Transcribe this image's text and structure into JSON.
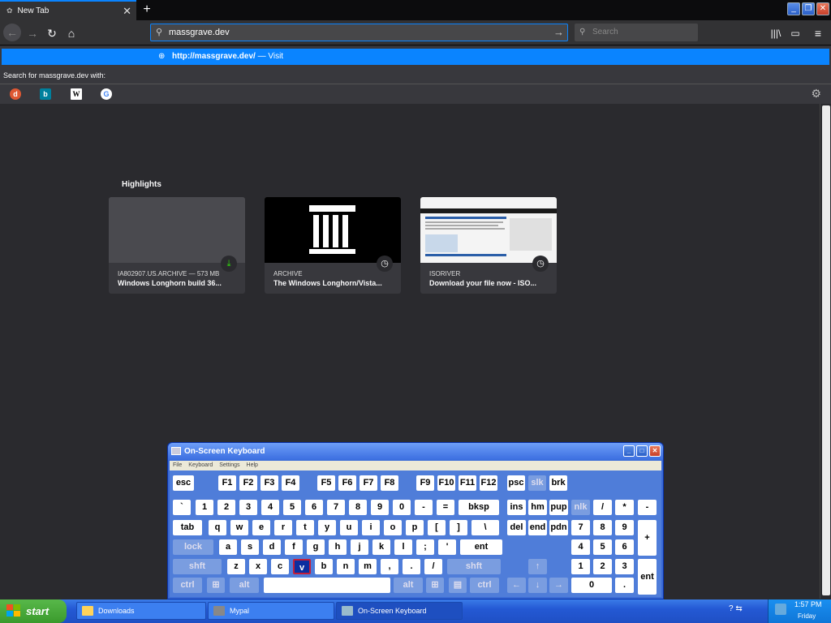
{
  "browser": {
    "tab_title": "New Tab",
    "tab_close": "✕",
    "new_tab": "+",
    "url_value": "massgrave.dev",
    "search_placeholder": "Search"
  },
  "dropdown": {
    "suggestion_url": "http://massgrave.dev/",
    "suggestion_action": "— Visit",
    "search_for_label": "Search for massgrave.dev with:",
    "engines": [
      "duckduckgo",
      "bing",
      "wikipedia",
      "google"
    ]
  },
  "highlights": {
    "title": "Highlights",
    "cards": [
      {
        "source": "IA802907.US.ARCHIVE — 573 MB",
        "title": "Windows Longhorn build 36...",
        "badge": "download-icon"
      },
      {
        "source": "ARCHIVE",
        "title": "The Windows Longhorn/Vista...",
        "badge": "clock-icon"
      },
      {
        "source": "ISORIVER",
        "title": "Download your file now - ISO...",
        "badge": "clock-icon"
      }
    ]
  },
  "osk": {
    "title": "On-Screen Keyboard",
    "menu": [
      "File",
      "Keyboard",
      "Settings",
      "Help"
    ],
    "rows": {
      "r0": [
        "esc",
        "F1",
        "F2",
        "F3",
        "F4",
        "F5",
        "F6",
        "F7",
        "F8",
        "F9",
        "F10",
        "F11",
        "F12",
        "psc",
        "slk",
        "brk"
      ],
      "r1": [
        "`",
        "1",
        "2",
        "3",
        "4",
        "5",
        "6",
        "7",
        "8",
        "9",
        "0",
        "-",
        "=",
        "bksp",
        "ins",
        "hm",
        "pup",
        "nlk",
        "/",
        "*",
        "-"
      ],
      "r2": [
        "tab",
        "q",
        "w",
        "e",
        "r",
        "t",
        "y",
        "u",
        "i",
        "o",
        "p",
        "[",
        "]",
        "\\",
        "del",
        "end",
        "pdn",
        "7",
        "8",
        "9",
        "+"
      ],
      "r3": [
        "lock",
        "a",
        "s",
        "d",
        "f",
        "g",
        "h",
        "j",
        "k",
        "l",
        ";",
        "'",
        "ent",
        "4",
        "5",
        "6"
      ],
      "r4": [
        "shft",
        "z",
        "x",
        "c",
        "v",
        "b",
        "n",
        "m",
        ",",
        ".",
        "/",
        "shft",
        "↑",
        "1",
        "2",
        "3",
        "ent"
      ],
      "r5": [
        "ctrl",
        "alt",
        "alt",
        "ctrl",
        "←",
        "↓",
        "→",
        "0",
        "."
      ]
    },
    "pressed_key": "v"
  },
  "taskbar": {
    "start": "start",
    "buttons": [
      "Downloads",
      "Mypal",
      "On-Screen Keyboard"
    ],
    "time": "1:57 PM",
    "day": "Friday"
  }
}
